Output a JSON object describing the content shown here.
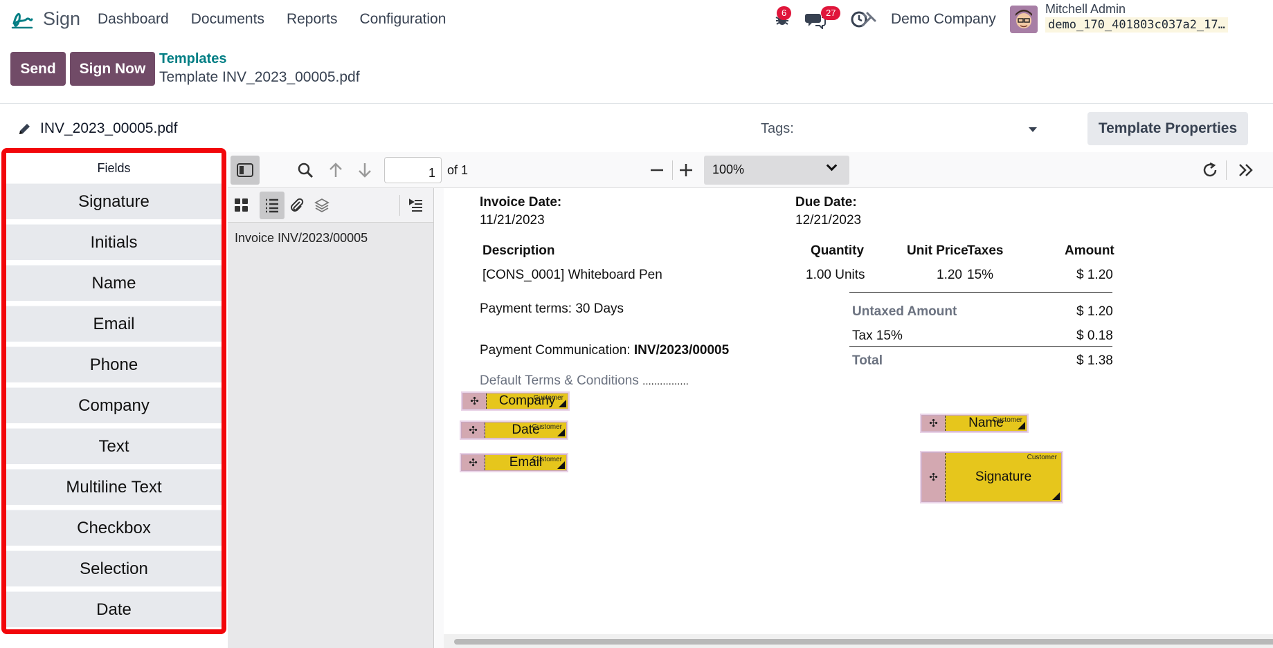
{
  "nav": {
    "app_name": "Sign",
    "menu": [
      "Dashboard",
      "Documents",
      "Reports",
      "Configuration"
    ],
    "messages_badge": "6",
    "activities_badge": "27",
    "company": "Demo Company",
    "user_name": "Mitchell Admin",
    "db_name": "demo_170_401803c037a2_17…"
  },
  "control": {
    "send_label": "Send",
    "sign_now_label": "Sign Now",
    "breadcrumb_parent": "Templates",
    "breadcrumb_current": "Template INV_2023_00005.pdf"
  },
  "template": {
    "file_name": "INV_2023_00005.pdf",
    "tags_label": "Tags:",
    "properties_button": "Template Properties"
  },
  "fields_panel": {
    "title": "Fields",
    "items": [
      "Signature",
      "Initials",
      "Name",
      "Email",
      "Phone",
      "Company",
      "Text",
      "Multiline Text",
      "Checkbox",
      "Selection",
      "Date"
    ]
  },
  "viewer": {
    "page_number": "1",
    "page_count": "of 1",
    "zoom": "100%",
    "outline_item": "Invoice INV/2023/00005"
  },
  "invoice": {
    "invoice_date_label": "Invoice Date:",
    "invoice_date": "11/21/2023",
    "due_date_label": "Due Date:",
    "due_date": "12/21/2023",
    "headers": {
      "description": "Description",
      "quantity": "Quantity",
      "unit_price": "Unit Price",
      "taxes": "Taxes",
      "amount": "Amount"
    },
    "line": {
      "description": "[CONS_0001] Whiteboard Pen",
      "quantity": "1.00 Units",
      "unit_price": "1.20",
      "taxes": "15%",
      "amount": "$ 1.20"
    },
    "payment_terms": "Payment terms: 30 Days",
    "payment_comm_label": "Payment Communication:",
    "payment_comm_value": "INV/2023/00005",
    "terms": "Default Terms & Conditions",
    "terms_dots": "................",
    "untaxed_label": "Untaxed Amount",
    "untaxed_value": "$ 1.20",
    "tax_label": "Tax 15%",
    "tax_value": "$ 0.18",
    "total_label": "Total",
    "total_value": "$ 1.38"
  },
  "sign_fields": [
    {
      "label": "Company",
      "role": "Customer"
    },
    {
      "label": "Date",
      "role": "Customer"
    },
    {
      "label": "Email",
      "role": "Customer"
    },
    {
      "label": "Name",
      "role": "Customer"
    },
    {
      "label": "Signature",
      "role": "Customer"
    }
  ],
  "colors": {
    "brand": "#714b67",
    "link": "#017e84",
    "highlight_border": "#f2060a",
    "field_fill": "#e6c61c",
    "badge": "#e0163b"
  }
}
